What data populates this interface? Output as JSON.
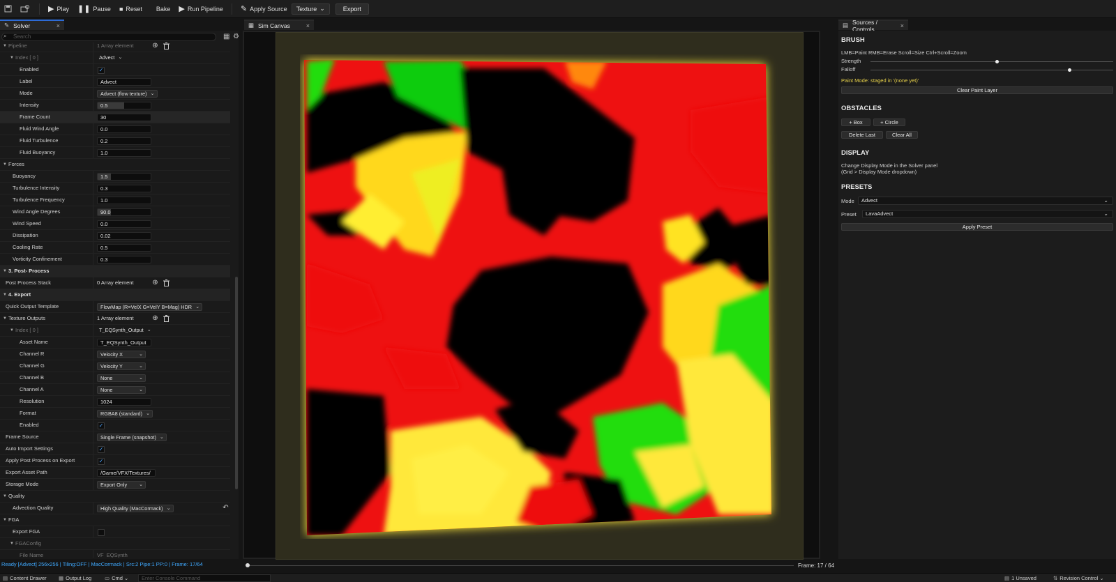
{
  "toolbar": {
    "play": "Play",
    "pause": "Pause",
    "reset": "Reset",
    "bake": "Bake",
    "run_pipeline": "Run Pipeline",
    "apply_source": "Apply Source",
    "texture": "Texture",
    "export": "Export"
  },
  "tabs": {
    "solver": "Solver",
    "sim_canvas": "Sim Canvas",
    "sources": "Sources / Controls"
  },
  "search": {
    "placeholder": "Search"
  },
  "details": [
    {
      "label": "Pipeline",
      "value": "1 Array element",
      "kind": "text-icons",
      "indent": 0,
      "arrow": true,
      "section": false,
      "dim": true
    },
    {
      "label": "Index [ 0 ]",
      "value": "Advect",
      "kind": "flatdd",
      "indent": 1,
      "arrow": true,
      "dim": true
    },
    {
      "label": "Enabled",
      "value": "",
      "kind": "check",
      "checked": true,
      "indent": 2
    },
    {
      "label": "Label",
      "value": "Advect",
      "kind": "input",
      "indent": 2
    },
    {
      "label": "Mode",
      "value": "Advect (flow texture)",
      "kind": "dd",
      "indent": 2
    },
    {
      "label": "Intensity",
      "value": "0.5",
      "kind": "input",
      "fill": 0.5,
      "indent": 2
    },
    {
      "label": "Frame Count",
      "value": "30",
      "kind": "input",
      "indent": 2,
      "hl": true
    },
    {
      "label": "Fluid Wind Angle",
      "value": "0.0",
      "kind": "input",
      "indent": 2
    },
    {
      "label": "Fluid Turbulence",
      "value": "0.2",
      "kind": "input",
      "indent": 2
    },
    {
      "label": "Fluid Buoyancy",
      "value": "1.0",
      "kind": "input",
      "indent": 2
    },
    {
      "label": "Forces",
      "value": "",
      "kind": "none",
      "indent": 0,
      "arrow": true
    },
    {
      "label": "Buoyancy",
      "value": "1.5",
      "kind": "input",
      "fill": 0.25,
      "indent": 1
    },
    {
      "label": "Turbulence Intensity",
      "value": "0.3",
      "kind": "input",
      "indent": 1
    },
    {
      "label": "Turbulence Frequency",
      "value": "1.0",
      "kind": "input",
      "indent": 1
    },
    {
      "label": "Wind Angle Degrees",
      "value": "90.0",
      "kind": "input",
      "fill": 0.25,
      "indent": 1
    },
    {
      "label": "Wind Speed",
      "value": "0.0",
      "kind": "input",
      "indent": 1
    },
    {
      "label": "Dissipation",
      "value": "0.02",
      "kind": "input",
      "indent": 1
    },
    {
      "label": "Cooling Rate",
      "value": "0.5",
      "kind": "input",
      "indent": 1
    },
    {
      "label": "Vorticity Confinement",
      "value": "0.3",
      "kind": "input",
      "indent": 1
    },
    {
      "label": "3. Post- Process",
      "value": "",
      "kind": "none",
      "indent": 0,
      "arrow": true,
      "section": true
    },
    {
      "label": "Post Process Stack",
      "value": "0 Array element",
      "kind": "text-icons",
      "indent": 0
    },
    {
      "label": "4. Export",
      "value": "",
      "kind": "none",
      "indent": 0,
      "arrow": true,
      "section": true
    },
    {
      "label": "Quick Output Template",
      "value": "FlowMap (R=VelX G=VelY B=Mag) HDR",
      "kind": "dd",
      "indent": 0
    },
    {
      "label": "Texture Outputs",
      "value": "1 Array element",
      "kind": "text-icons",
      "indent": 0,
      "arrow": true
    },
    {
      "label": "Index [ 0 ]",
      "value": "T_EQSynth_Output",
      "kind": "flatdd",
      "indent": 1,
      "arrow": true,
      "dim": true
    },
    {
      "label": "Asset Name",
      "value": "T_EQSynth_Output",
      "kind": "input",
      "indent": 2
    },
    {
      "label": "Channel R",
      "value": "Velocity X",
      "kind": "dd",
      "w": 70,
      "indent": 2
    },
    {
      "label": "Channel G",
      "value": "Velocity Y",
      "kind": "dd",
      "w": 70,
      "indent": 2
    },
    {
      "label": "Channel B",
      "value": "None",
      "kind": "dd",
      "w": 70,
      "indent": 2
    },
    {
      "label": "Channel A",
      "value": "None",
      "kind": "dd",
      "w": 70,
      "indent": 2
    },
    {
      "label": "Resolution",
      "value": "1024",
      "kind": "input",
      "indent": 2
    },
    {
      "label": "Format",
      "value": "RGBA8 (standard)",
      "kind": "dd",
      "indent": 2
    },
    {
      "label": "Enabled",
      "value": "",
      "kind": "check",
      "checked": true,
      "indent": 2
    },
    {
      "label": "Frame Source",
      "value": "Single Frame (snapshot)",
      "kind": "dd",
      "indent": 0
    },
    {
      "label": "Auto Import Settings",
      "value": "",
      "kind": "check",
      "checked": true,
      "indent": 0
    },
    {
      "label": "Apply Post Process on Export",
      "value": "",
      "kind": "check",
      "checked": true,
      "indent": 0
    },
    {
      "label": "Export Asset Path",
      "value": "/Game/VFX/Textures/",
      "kind": "input",
      "w": 84,
      "indent": 0
    },
    {
      "label": "Storage Mode",
      "value": "Export Only",
      "kind": "dd",
      "w": 70,
      "indent": 0
    },
    {
      "label": "Quality",
      "value": "",
      "kind": "none",
      "indent": 0,
      "arrow": true
    },
    {
      "label": "Advection Quality",
      "value": "High Quality (MacCormack)",
      "kind": "dd",
      "indent": 1,
      "reset": true
    },
    {
      "label": "FGA",
      "value": "",
      "kind": "none",
      "indent": 0,
      "arrow": true
    },
    {
      "label": "Export FGA",
      "value": "",
      "kind": "check",
      "checked": false,
      "indent": 1
    },
    {
      "label": "FGAConfig",
      "value": "",
      "kind": "none",
      "indent": 1,
      "arrow": true,
      "dim": true
    },
    {
      "label": "File Name",
      "value": "VF_EQSynth",
      "kind": "text",
      "indent": 2,
      "dim": true
    }
  ],
  "status_bar": "Ready [Advect] 256x256 | Tiling:OFF | MacCormack | Src:2 Pipe:1 PP:0 | Frame: 17/64",
  "frame_label": "Frame: 17 / 64",
  "timeline": {
    "progress": 0.0
  },
  "right": {
    "brush_title": "BRUSH",
    "brush_hint": "LMB=Paint  RMB=Erase  Scroll=Size  Ctrl+Scroll=Zoom",
    "strength_label": "Strength",
    "strength_value": 0.52,
    "falloff_label": "Falloff",
    "falloff_value": 0.82,
    "paint_mode": "Paint Mode: staged in '(none yet)'",
    "clear_paint": "Clear Paint Layer",
    "obstacles_title": "OBSTACLES",
    "add_box": "+ Box",
    "add_circle": "+ Circle",
    "delete_last": "Delete Last",
    "clear_all": "Clear All",
    "display_title": "DISPLAY",
    "display_line1": "Change Display Mode in the Solver panel",
    "display_line2": "(Grid > Display Mode dropdown)",
    "presets_title": "PRESETS",
    "mode_label": "Mode",
    "mode_value": "Advect",
    "preset_label": "Preset",
    "preset_value": "LavaAdvect",
    "apply_preset": "Apply Preset"
  },
  "bottom": {
    "content_drawer": "Content Drawer",
    "output_log": "Output Log",
    "cmd": "Cmd",
    "console_placeholder": "Enter Console Command",
    "unsaved": "1 Unsaved",
    "revision_control": "Revision Control"
  },
  "colors": {
    "accent": "#2d6bd6",
    "status": "#3fa9ff",
    "paint_mode": "#e8d24a"
  }
}
